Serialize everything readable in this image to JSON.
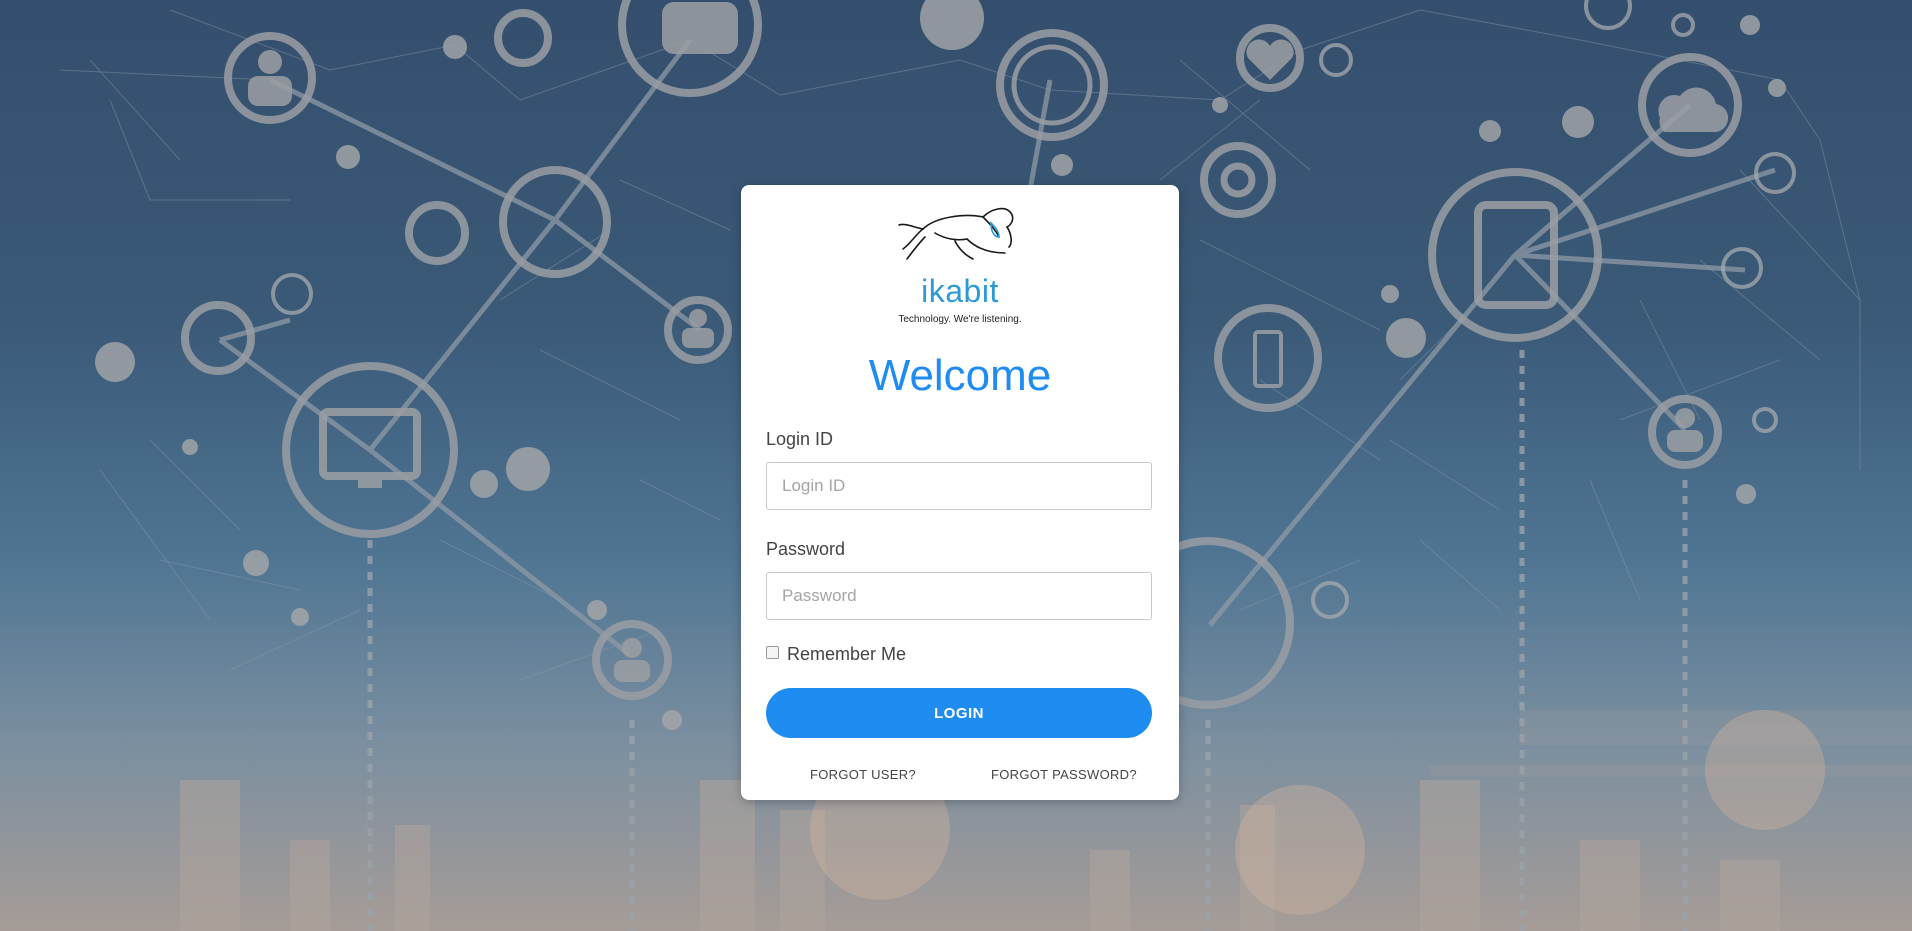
{
  "brand": {
    "name": "ikabit",
    "tagline": "Technology. We're listening.",
    "logo_icon": "elephant-logo",
    "accent_color": "#1e8cf0"
  },
  "login_card": {
    "heading": "Welcome",
    "login_id": {
      "label": "Login ID",
      "placeholder": "Login ID",
      "value": ""
    },
    "password": {
      "label": "Password",
      "placeholder": "Password",
      "value": ""
    },
    "remember_me": {
      "label": "Remember Me",
      "checked": false
    },
    "login_button_label": "LOGIN",
    "forgot_user_label": "FORGOT USER?",
    "forgot_password_label": "FORGOT PASSWORD?"
  },
  "background": {
    "theme": "network-connections-over-city-skyline",
    "icons": [
      "user-icon",
      "share-icon",
      "chat-icon",
      "globe-icon",
      "heart-icon",
      "cloud-icon",
      "wifi-icon",
      "mail-icon",
      "gear-icon",
      "tablet-icon",
      "refresh-icon",
      "monitor-icon",
      "battery-icon",
      "laptop-icon"
    ]
  }
}
